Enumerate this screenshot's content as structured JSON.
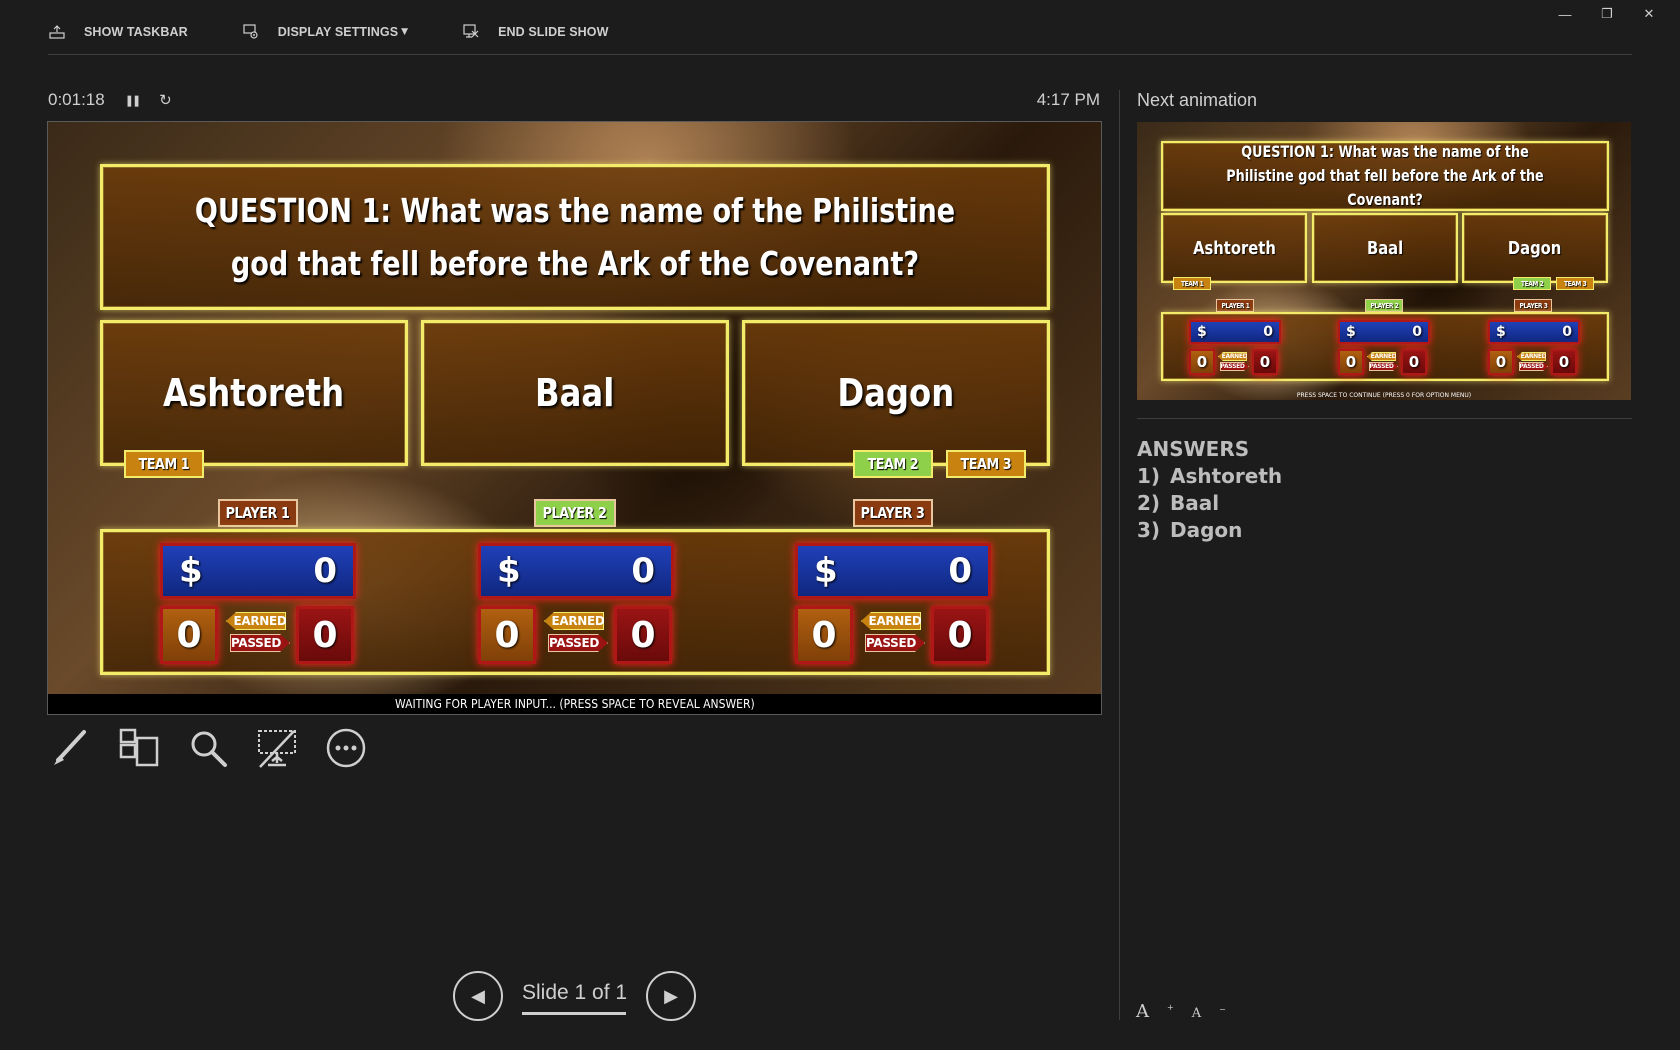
{
  "toolbar": {
    "show_taskbar": "SHOW TASKBAR",
    "display_settings": "DISPLAY SETTINGS",
    "display_settings_caret": "▼",
    "end_slide_show": "END SLIDE SHOW"
  },
  "window_controls": {
    "minimize": "—",
    "restore": "❐",
    "close": "✕"
  },
  "presenter": {
    "timer": "0:01:18",
    "pause_icon": "❚❚",
    "reset_icon": "↻",
    "clock": "4:17 PM"
  },
  "slide": {
    "question": "QUESTION 1:  What was the name of the Philistine god that fell before the Ark of the Covenant?",
    "answers": [
      "Ashtoreth",
      "Baal",
      "Dagon"
    ],
    "teams": [
      "TEAM 1",
      "TEAM 2",
      "TEAM 3"
    ],
    "players": [
      "PLAYER 1",
      "PLAYER 2",
      "PLAYER 3"
    ],
    "currency": "$",
    "scores": [
      "0",
      "0",
      "0"
    ],
    "earned": [
      "0",
      "0",
      "0"
    ],
    "passed": [
      "0",
      "0",
      "0"
    ],
    "earned_label": "EARNED",
    "passed_label": "PASSED",
    "status": "WAITING FOR PLAYER INPUT... (PRESS SPACE TO REVEAL ANSWER)"
  },
  "tools": [
    "pen-tool",
    "see-all-slides",
    "zoom",
    "black-screen",
    "more-options"
  ],
  "navigation": {
    "counter": "Slide 1 of 1",
    "prev_icon": "◀",
    "next_icon": "▶"
  },
  "next_panel": {
    "title": "Next animation",
    "question": "QUESTION 1:  What was the name of the Philistine god that fell before the Ark of the Covenant?",
    "answers": [
      "Ashtoreth",
      "Baal",
      "Dagon"
    ],
    "teams": [
      "TEAM 1",
      "TEAM 2",
      "TEAM 3"
    ],
    "players": [
      "PLAYER 1",
      "PLAYER 2",
      "PLAYER 3"
    ],
    "footer": "PRESS SPACE TO CONTINUE (PRESS 0 FOR OPTION MENU)"
  },
  "notes": {
    "heading": "ANSWERS",
    "items": [
      {
        "num": "1)",
        "text": "Ashtoreth"
      },
      {
        "num": "2)",
        "text": "Baal"
      },
      {
        "num": "3)",
        "text": "Dagon"
      }
    ]
  },
  "font_controls": {
    "increase": "A",
    "decrease": "A"
  },
  "colors": {
    "background": "#1c1c1c",
    "gold_border": "#f2ec6a",
    "team_gold": "#c78210",
    "team_green": "#8fd04a",
    "money_blue": "#2040b8",
    "score_red": "#b01818"
  }
}
